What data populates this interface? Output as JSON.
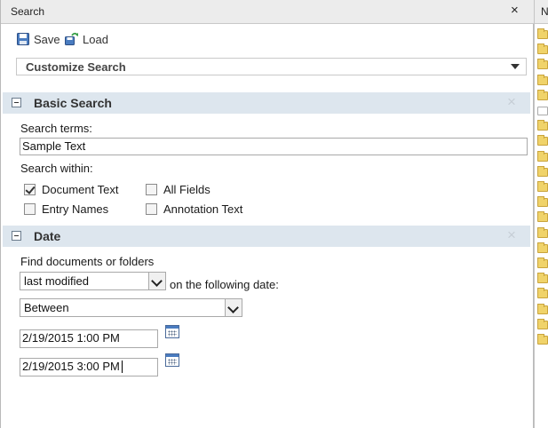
{
  "panel": {
    "title": "Search",
    "close_glyph": "×"
  },
  "toolbar": {
    "save_label": "Save",
    "save_icon": "save-icon",
    "load_label": "Load",
    "load_icon": "load-icon"
  },
  "customize": {
    "selected": "Customize Search"
  },
  "basic_search": {
    "title": "Basic Search",
    "close_glyph": "×",
    "search_terms_label": "Search terms:",
    "search_terms_value": "Sample Text",
    "search_within_label": "Search within:",
    "options": [
      {
        "label": "Document Text",
        "checked": true
      },
      {
        "label": "All Fields",
        "checked": false
      },
      {
        "label": "Entry Names",
        "checked": false
      },
      {
        "label": "Annotation Text",
        "checked": false
      }
    ]
  },
  "date": {
    "title": "Date",
    "close_glyph": "×",
    "find_label": "Find documents or folders",
    "field_selected": "last modified",
    "following_label": "on the following date:",
    "operator_selected": "Between",
    "start_value": "2/19/2015 1:00 PM",
    "end_value": "2/19/2015 3:00 PM"
  },
  "right_pane": {
    "header_letter": "N"
  },
  "colors": {
    "section_header_bg": "#dde6ee",
    "folder_yellow": "#f0d36a"
  }
}
